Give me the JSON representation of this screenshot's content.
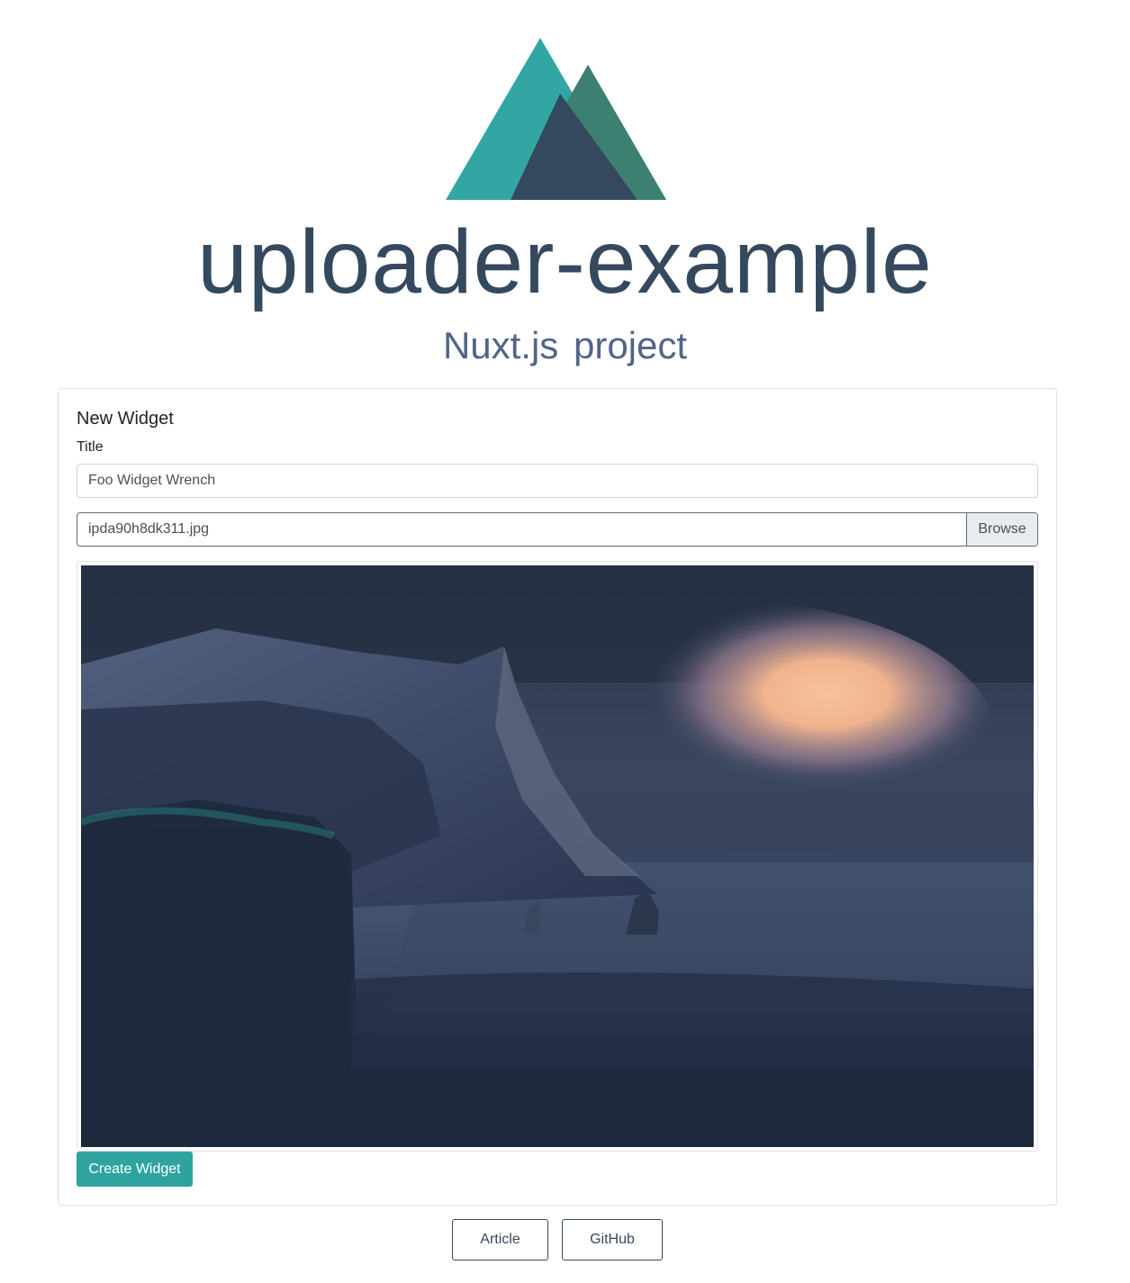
{
  "colors": {
    "nuxt_green": "#2fa39f",
    "nuxt_dark": "#35495e",
    "nuxt_mid": "#3b8070"
  },
  "header": {
    "logo_icon": "nuxt-logo-icon",
    "title": "uploader-example",
    "subtitle": "Nuxt.js project"
  },
  "form": {
    "card_title": "New Widget",
    "title_label": "Title",
    "title_value": "Foo Widget Wrench",
    "file_name": "ipda90h8dk311.jpg",
    "browse_label": "Browse",
    "preview_icon": "uploaded-image-preview",
    "submit_label": "Create Widget"
  },
  "links": {
    "article_label": "Article",
    "github_label": "GitHub"
  }
}
